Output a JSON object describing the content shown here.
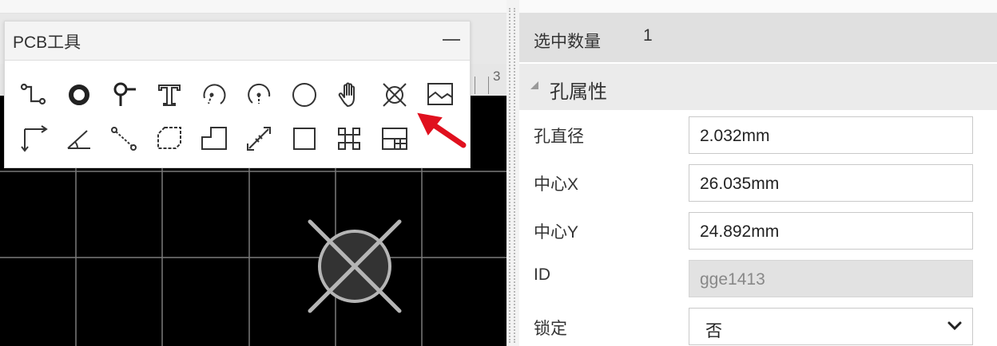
{
  "toolbar": {
    "title": "PCB工具",
    "tools_row1": [
      "track-icon",
      "pad-icon",
      "via-icon",
      "text-icon",
      "arc-icon",
      "center-arc-icon",
      "circle-icon",
      "pan-hand-icon",
      "hole-icon",
      "image-icon"
    ],
    "tools_row2": [
      "dimension-icon",
      "angle-icon",
      "connect-icon",
      "copper-area-icon",
      "solid-region-icon",
      "measure-icon",
      "rectangle-icon",
      "canvas-origin-icon",
      "table-icon"
    ]
  },
  "ruler": {
    "label": "3"
  },
  "properties": {
    "selected_count_label": "选中数量",
    "selected_count_value": "1",
    "group_title": "孔属性",
    "fields": [
      {
        "label": "孔直径",
        "value": "2.032mm"
      },
      {
        "label": "中心X",
        "value": "26.035mm"
      },
      {
        "label": "中心Y",
        "value": "24.892mm"
      },
      {
        "label": "ID",
        "value": "gge1413"
      }
    ],
    "lock": {
      "label": "锁定",
      "value": "否"
    }
  },
  "colors": {
    "canvas_background": "#000000",
    "grid_line": "#7a7a7a",
    "hole_marker": "#b5b5b5",
    "annotation_arrow": "#e0101e"
  }
}
